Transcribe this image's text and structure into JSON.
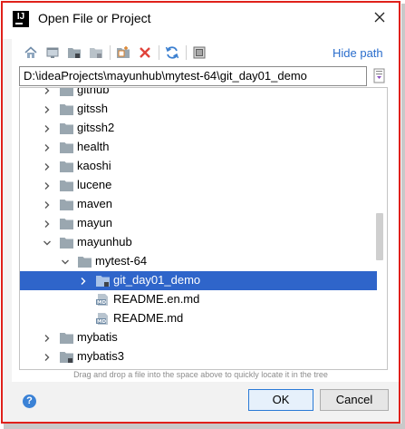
{
  "window": {
    "title": "Open File or Project",
    "app_icon_text": "IJ"
  },
  "toolbar": {
    "icons": [
      "home-icon",
      "desktop-icon",
      "project-folder-icon",
      "module-folder-icon",
      "new-folder-icon",
      "delete-icon",
      "refresh-icon",
      "show-hidden-icon"
    ],
    "hide_path_label": "Hide path"
  },
  "path_field": {
    "value": "D:\\ideaProjects\\mayunhub\\mytest-64\\git_day01_demo"
  },
  "tree": {
    "rows": [
      {
        "label": "github",
        "arrow": "collapsed",
        "icon": "folder-icon"
      },
      {
        "label": "gitssh",
        "arrow": "collapsed",
        "icon": "folder-icon"
      },
      {
        "label": "gitssh2",
        "arrow": "collapsed",
        "icon": "folder-icon"
      },
      {
        "label": "health",
        "arrow": "collapsed",
        "icon": "folder-icon"
      },
      {
        "label": "kaoshi",
        "arrow": "collapsed",
        "icon": "folder-icon"
      },
      {
        "label": "lucene",
        "arrow": "collapsed",
        "icon": "folder-icon"
      },
      {
        "label": "maven",
        "arrow": "collapsed",
        "icon": "folder-icon"
      },
      {
        "label": "mayun",
        "arrow": "collapsed",
        "icon": "folder-icon"
      },
      {
        "label": "mayunhub",
        "arrow": "expanded",
        "icon": "folder-icon"
      },
      {
        "label": "mytest-64",
        "arrow": "expanded",
        "icon": "folder-icon"
      },
      {
        "label": "git_day01_demo",
        "arrow": "collapsed",
        "icon": "project-folder-icon",
        "selected": true
      },
      {
        "label": "README.en.md",
        "arrow": "none",
        "icon": "markdown-file-icon"
      },
      {
        "label": "README.md",
        "arrow": "none",
        "icon": "markdown-file-icon"
      },
      {
        "label": "mybatis",
        "arrow": "collapsed",
        "icon": "folder-icon"
      },
      {
        "label": "mybatis3",
        "arrow": "collapsed",
        "icon": "project-folder-icon"
      }
    ]
  },
  "hint": "Drag and drop a file into the space above to quickly locate it in the tree",
  "buttons": {
    "help": "?",
    "ok": "OK",
    "cancel": "Cancel"
  },
  "colors": {
    "selection": "#2f65ca",
    "link": "#2a6dcc",
    "frame": "#e0211b",
    "folder": "#9aa7b0"
  }
}
